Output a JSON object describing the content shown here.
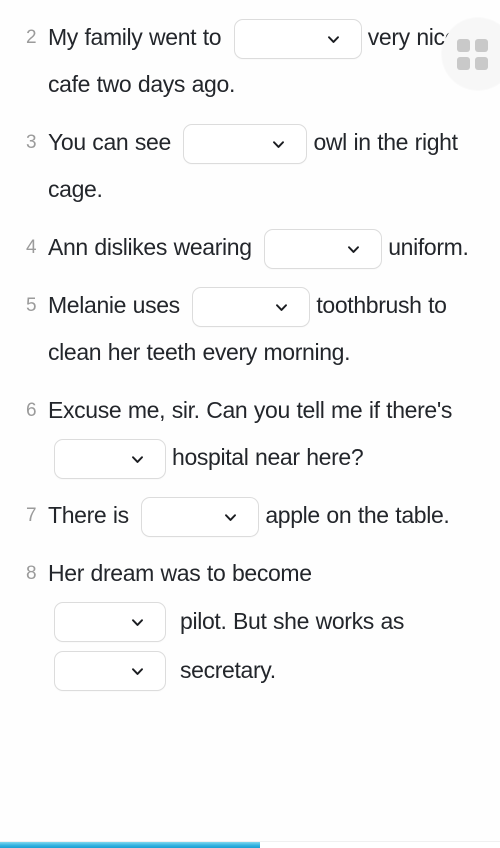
{
  "page": {
    "background_color": "#fefefe",
    "text_color": "#23262b",
    "number_color": "#9b9b9b",
    "dropdown_border_color": "#dcdcdc"
  },
  "fab": {
    "icon": "grid-2x2-icon",
    "color": "#c9c9c9",
    "background": "#f7f7f7"
  },
  "progress": {
    "percent": 52,
    "color": "#35b3e0"
  },
  "dropdown": {
    "selected_value": "",
    "placeholder": "",
    "chevron_icon": "chevron-down-icon"
  },
  "questions": [
    {
      "number": "2",
      "parts": [
        {
          "type": "text",
          "value": "My family went to "
        },
        {
          "type": "select",
          "size": "xl"
        },
        {
          "type": "text",
          "value": "very nice cafe two days ago."
        }
      ]
    },
    {
      "number": "3",
      "parts": [
        {
          "type": "text",
          "value": "You can see "
        },
        {
          "type": "select",
          "size": "lg"
        },
        {
          "type": "text",
          "value": "owl in the right cage."
        }
      ]
    },
    {
      "number": "4",
      "parts": [
        {
          "type": "text",
          "value": "Ann dislikes wearing "
        },
        {
          "type": "select",
          "size": "md"
        },
        {
          "type": "text",
          "value": "uniform."
        }
      ]
    },
    {
      "number": "5",
      "parts": [
        {
          "type": "text",
          "value": "Melanie uses "
        },
        {
          "type": "select",
          "size": "md"
        },
        {
          "type": "text",
          "value": "toothbrush to clean her teeth every morning."
        }
      ]
    },
    {
      "number": "6",
      "parts": [
        {
          "type": "text",
          "value": "Excuse me, sir. Can you tell me if there's "
        },
        {
          "type": "select",
          "size": "sm"
        },
        {
          "type": "text",
          "value": "hospital near here?"
        }
      ]
    },
    {
      "number": "7",
      "parts": [
        {
          "type": "text",
          "value": "There is "
        },
        {
          "type": "select",
          "size": "md"
        },
        {
          "type": "text",
          "value": "apple on the table."
        }
      ]
    },
    {
      "number": "8",
      "parts": [
        {
          "type": "text",
          "value": "Her dream was to become"
        }
      ],
      "rows": [
        {
          "select_size": "sm",
          "text": "pilot. But she works as"
        },
        {
          "select_size": "sm",
          "text": "secretary."
        }
      ]
    }
  ]
}
